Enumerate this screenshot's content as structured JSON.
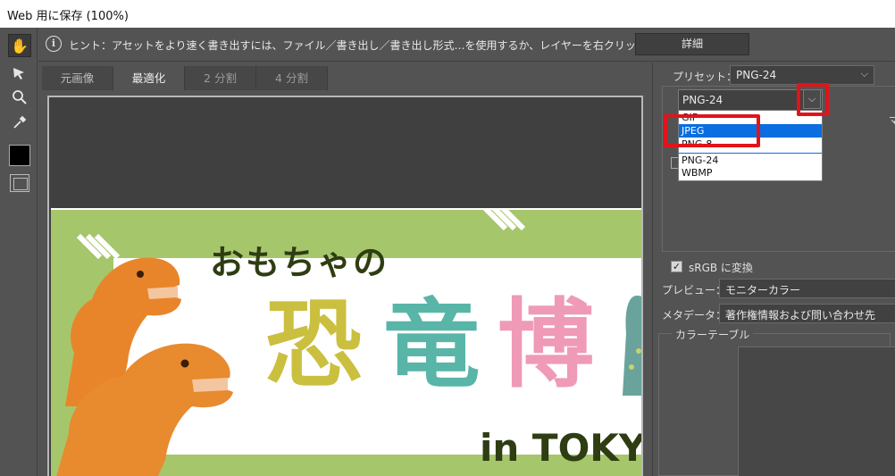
{
  "window": {
    "title": "Web 用に保存 (100%)"
  },
  "hint": {
    "text": "ヒント：アセットをより速く書き出すには、ファイル／書き出し／書き出し形式…を使用するか、レイヤーを右クリックして使用。",
    "detail_button": "詳細"
  },
  "tabs": [
    {
      "label": "元画像",
      "active": false
    },
    {
      "label": "最適化",
      "active": true
    },
    {
      "label": "2 分割",
      "active": false
    },
    {
      "label": "4 分割",
      "active": false
    }
  ],
  "image": {
    "title_line": "おもちゃの",
    "big_chars": [
      "恐",
      "竜",
      "博"
    ],
    "location": "in TOKYO"
  },
  "settings": {
    "preset_label": "プリセット：",
    "preset_value": "PNG-24",
    "format_value": "PNG-24",
    "format_options": [
      "GIF",
      "JPEG",
      "PNG-8",
      "PNG-24",
      "WBMP"
    ],
    "format_highlighted": "JPEG",
    "srgb_label": "sRGB に変換",
    "srgb_checked": true,
    "preview_label": "プレビュー：",
    "preview_value": "モニターカラー",
    "metadata_label": "メタデータ：",
    "metadata_value": "著作権情報および問い合わせ先",
    "color_table_label": "カラーテーブル"
  },
  "colors": {
    "accent_red": "#e0141a",
    "selection_blue": "#0a6de0",
    "banner_green": "#a6c66c"
  },
  "icons": [
    "hand-icon",
    "slice-select-icon",
    "zoom-icon",
    "eyedropper-icon",
    "info-icon",
    "chevron-down-icon"
  ]
}
